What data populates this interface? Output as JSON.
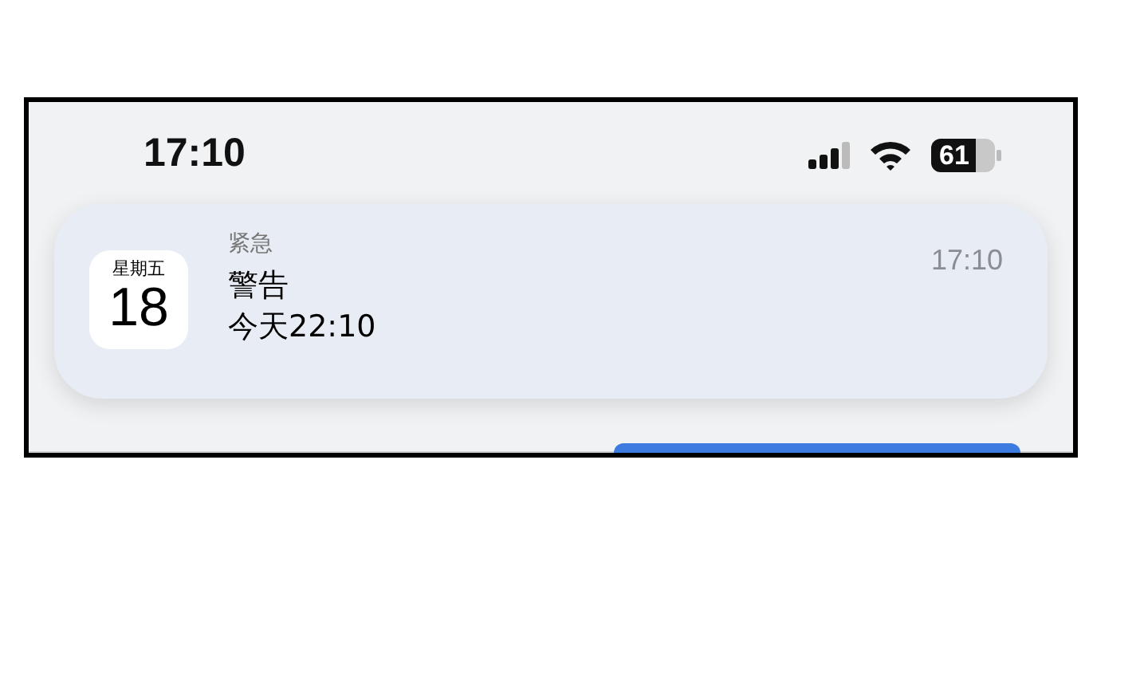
{
  "status_bar": {
    "time": "17:10",
    "battery": "61"
  },
  "notification": {
    "calendar_weekday": "星期五",
    "calendar_day": "18",
    "app": "紧急",
    "time": "17:10",
    "title": "警告",
    "body": "今天22:10"
  }
}
